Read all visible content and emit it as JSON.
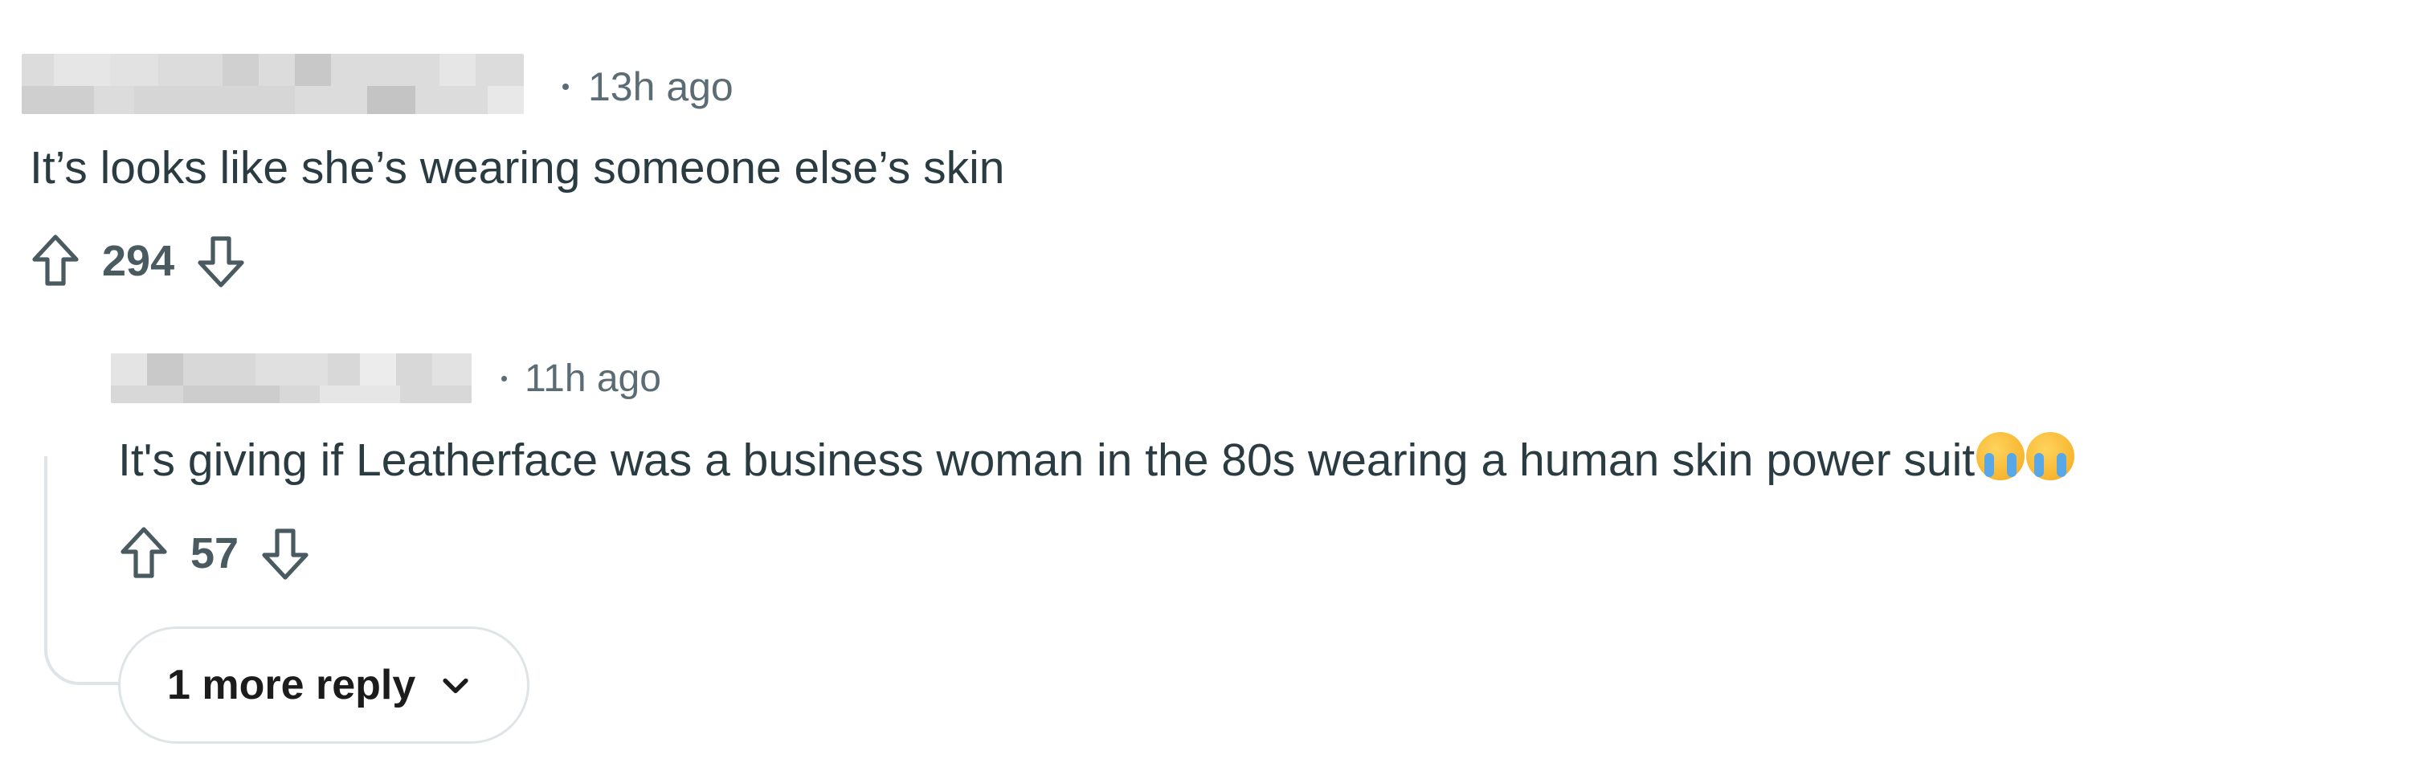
{
  "comments": [
    {
      "time": "13h ago",
      "text": "It’s looks like she’s wearing someone else’s skin",
      "score": "294"
    },
    {
      "time": "11h ago",
      "text": "It's giving if Leatherface was a business woman in the 80s wearing a human skin power suit",
      "emojis": [
        "loudly-crying-face-emoji",
        "loudly-crying-face-emoji"
      ],
      "score": "57"
    }
  ],
  "more_replies_label": "1 more reply",
  "colors": {
    "meta": "#5c6c74",
    "text": "#2a3c42",
    "score": "#4a5a61",
    "thread_line": "#dfe4e6"
  }
}
